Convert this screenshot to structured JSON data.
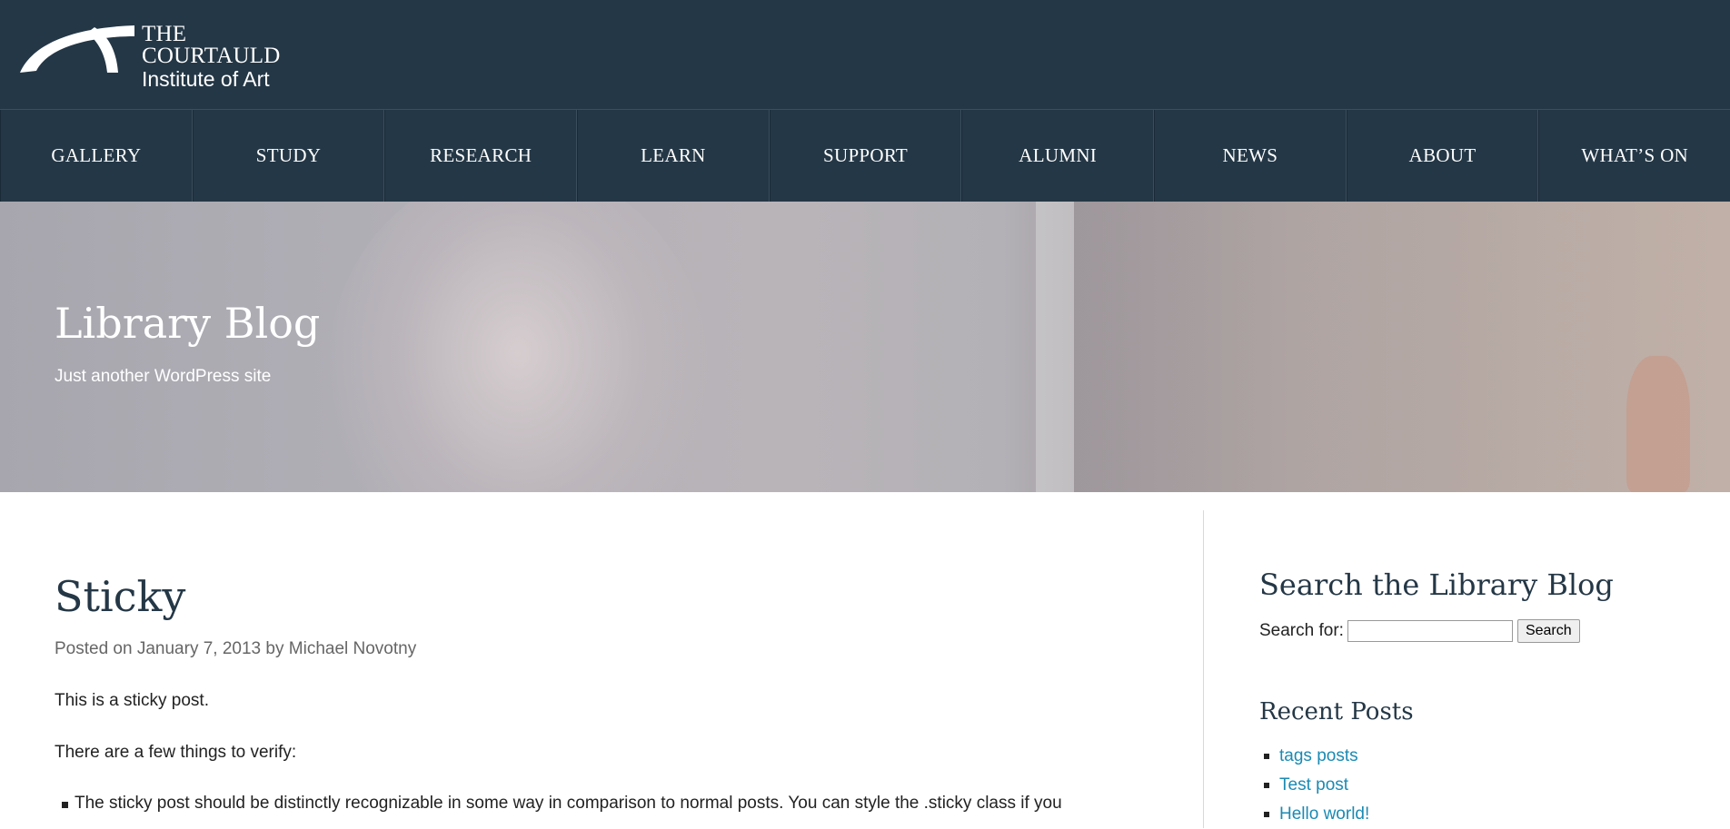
{
  "logo": {
    "line1": "THE",
    "line2": "COURTAULD",
    "line3": "Institute of Art"
  },
  "nav": {
    "items": [
      {
        "label": "GALLERY"
      },
      {
        "label": "STUDY"
      },
      {
        "label": "RESEARCH"
      },
      {
        "label": "LEARN"
      },
      {
        "label": "SUPPORT"
      },
      {
        "label": "ALUMNI"
      },
      {
        "label": "NEWS"
      },
      {
        "label": "ABOUT"
      },
      {
        "label": "WHAT’S ON"
      }
    ]
  },
  "hero": {
    "title": "Library Blog",
    "subtitle": "Just another WordPress site"
  },
  "post": {
    "title": "Sticky",
    "meta_prefix": "Posted on",
    "date": "January 7, 2013",
    "meta_by": "by",
    "author": "Michael Novotny",
    "paragraph1": "This is a sticky post.",
    "paragraph2": "There are a few things to verify:",
    "bullet1": "The sticky post should be distinctly recognizable in some way in comparison to normal posts. You can style the .sticky class if you"
  },
  "sidebar": {
    "search_title": "Search the Library Blog",
    "search_label": "Search for:",
    "search_value": "",
    "search_button": "Search",
    "recent_title": "Recent Posts",
    "recent_posts": [
      {
        "label": "tags posts"
      },
      {
        "label": "Test post"
      },
      {
        "label": "Hello world!"
      }
    ]
  },
  "colors": {
    "header_bg": "#243746",
    "link": "#1b8ab3",
    "heading": "#243746"
  }
}
